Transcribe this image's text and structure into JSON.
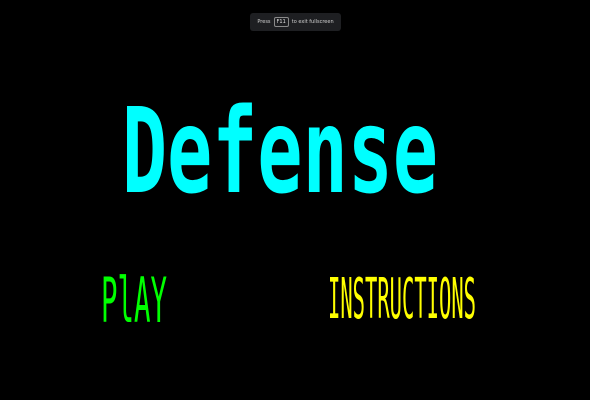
{
  "fullscreen_notice": {
    "prefix": "Press",
    "key": "F11",
    "suffix": "to exit fullscreen"
  },
  "game": {
    "title": "Defense",
    "title_color": "#00ffff"
  },
  "menu": {
    "play": {
      "label": "PlAY",
      "color": "#00ff00"
    },
    "instructions": {
      "label": "INSTRUCTIONS",
      "color": "#ffff00"
    }
  }
}
